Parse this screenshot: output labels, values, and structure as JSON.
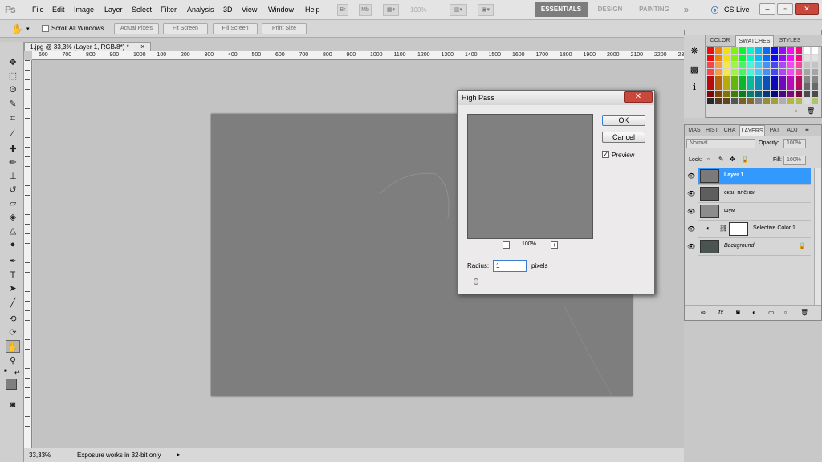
{
  "menubar": {
    "logo": "Ps",
    "menus": [
      "File",
      "Edit",
      "Image",
      "Layer",
      "Select",
      "Filter",
      "Analysis",
      "3D",
      "View",
      "Window",
      "Help"
    ],
    "bridge_label": "Br",
    "mini_bridge_label": "Mb",
    "zoom_value": "100%",
    "workspaces": [
      "ESSENTIALS",
      "DESIGN",
      "PAINTING"
    ],
    "more_workspaces": "»",
    "cs_live": "CS Live",
    "win_minimize": "–",
    "win_restore": "▫",
    "win_close": "✕"
  },
  "options": {
    "scroll_all_windows": "Scroll All Windows",
    "actual_pixels": "Actual Pixels",
    "fit_screen": "Fit Screen",
    "fill_screen": "Fill Screen",
    "print_size": "Print Size"
  },
  "document": {
    "tab_title": "1.jpg @ 33,3% (Layer 1, RGB/8*) *",
    "tab_close": "×",
    "ruler_labels": [
      "600",
      "700",
      "800",
      "900",
      "1000",
      "100",
      "200",
      "300",
      "400",
      "500",
      "600",
      "700",
      "800",
      "900",
      "1000",
      "1100",
      "1200",
      "1300",
      "1400",
      "1500",
      "1600",
      "1700",
      "1800",
      "1900",
      "2000",
      "2100",
      "2200",
      "230"
    ]
  },
  "status": {
    "zoom": "33,33%",
    "message": "Exposure works in 32-bit only"
  },
  "dialog": {
    "title": "High Pass",
    "close": "✕",
    "ok": "OK",
    "cancel": "Cancel",
    "preview_checked": true,
    "preview_label": "Preview",
    "zoom_out": "−",
    "zoom_level": "100%",
    "zoom_in": "+",
    "radius_label": "Radius:",
    "radius_value": "1",
    "radius_unit": "pixels"
  },
  "swatch_panel": {
    "tabs": [
      "COLOR",
      "SWATCHES",
      "STYLES"
    ],
    "active_tab": "SWATCHES"
  },
  "layers_panel": {
    "tabs": [
      "MAS",
      "HIST",
      "CHA",
      "LAYERS",
      "PAT",
      "ADJ"
    ],
    "active_tab": "LAYERS",
    "blend_mode": "Normal",
    "opacity_label": "Opacity:",
    "opacity_value": "100%",
    "lock_label": "Lock:",
    "fill_label": "Fill:",
    "fill_value": "100%",
    "layers": [
      {
        "name": "Layer 1",
        "selected": true,
        "thumb": "#7a7a7a"
      },
      {
        "name": "скан плёнки",
        "selected": false,
        "thumb": "#5e5e5e"
      },
      {
        "name": "шум",
        "selected": false,
        "thumb": "#8c8c8c"
      },
      {
        "name": "Selective Color 1",
        "selected": false,
        "thumb": "#ffffff"
      },
      {
        "name": "Background",
        "selected": false,
        "thumb": "#4a5552"
      }
    ]
  },
  "colors": {
    "selected_layer": "#3399ff",
    "dialog_close": "#c9473b"
  }
}
